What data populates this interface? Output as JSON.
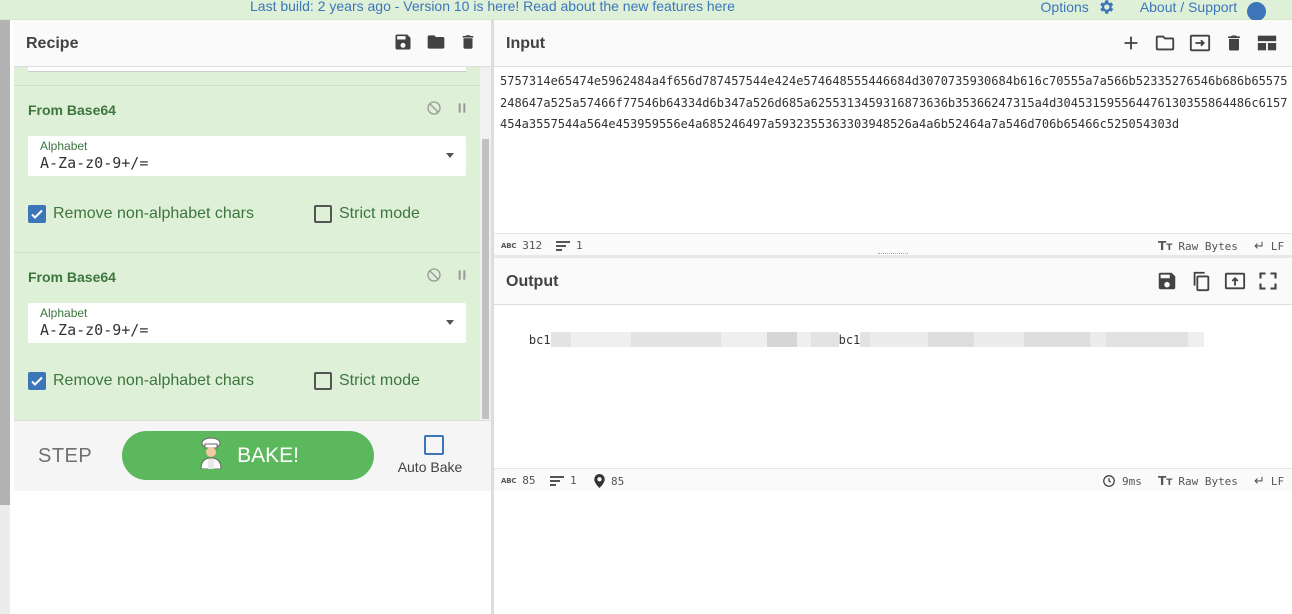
{
  "banner": {
    "notice_text": "Last build: 2 years ago - Version 10 is here! Read about the new features ",
    "notice_link": "here",
    "options_label": "Options",
    "about_label": "About / Support",
    "help_glyph": "?"
  },
  "recipe": {
    "title": "Recipe",
    "icons": [
      "save-icon",
      "folder-icon",
      "trash-icon"
    ],
    "operations": [
      {
        "name": "From Base64",
        "alphabet_label": "Alphabet",
        "alphabet_value": "A-Za-z0-9+/=",
        "remove_nonalpha_label": "Remove non-alphabet chars",
        "remove_nonalpha_checked": true,
        "strict_label": "Strict mode",
        "strict_checked": false
      },
      {
        "name": "From Base64",
        "alphabet_label": "Alphabet",
        "alphabet_value": "A-Za-z0-9+/=",
        "remove_nonalpha_label": "Remove non-alphabet chars",
        "remove_nonalpha_checked": true,
        "strict_label": "Strict mode",
        "strict_checked": false
      }
    ]
  },
  "controls": {
    "step_label": "STEP",
    "bake_label": "BAKE!",
    "autobake_label": "Auto Bake"
  },
  "input": {
    "title": "Input",
    "text": "5757314e65474e5962484a4f656d787457544e424e574648555446684d3070735930684b616c70555a7a566b52335276546b686b65575248647a525a57466f77546b64334d6b347a526d685a6255313459316873636b35366247315a4d304531595564476130355864486c6157454a3557544a564e453959556e4a685246497a5932355363303948526a4a6b52464a7a546d706b65466c525054303d",
    "status": {
      "chars_abbr": "ABC",
      "chars": "312",
      "lines": "1",
      "format_label": "Raw Bytes",
      "eol_label": "LF"
    }
  },
  "output": {
    "title": "Output",
    "text_start": "bc1",
    "text_mid": "bc1",
    "status": {
      "chars_abbr": "ABC",
      "chars": "85",
      "lines": "1",
      "position": "85",
      "time": "9ms",
      "format_label": "Raw Bytes",
      "eol_label": "LF"
    }
  },
  "colors": {
    "accent": "#3c76b9",
    "op_background": "#dff0d8",
    "op_text": "#3c763d",
    "bake_button": "#5cb85c"
  }
}
